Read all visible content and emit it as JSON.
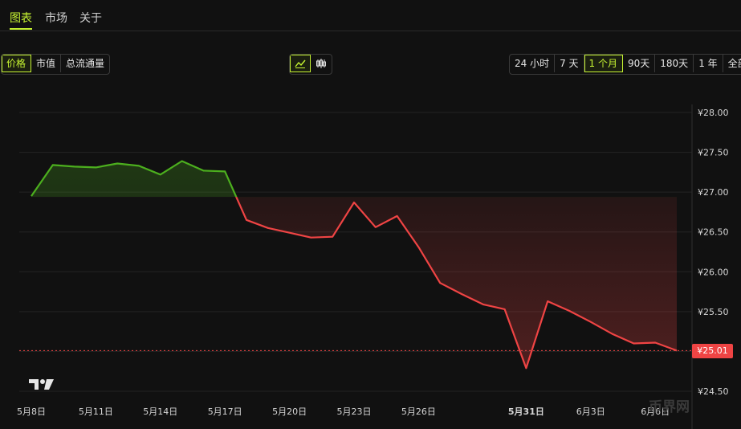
{
  "tabs": {
    "items": [
      "图表",
      "市场",
      "关于"
    ]
  },
  "metric_buttons": [
    "价格",
    "市值",
    "总流通量"
  ],
  "range_buttons": [
    "24 小时",
    "7 天",
    "1 个月",
    "90天",
    "180天",
    "1 年",
    "全部"
  ],
  "current_price_label": "¥25.01",
  "watermark": "币界网",
  "colors": {
    "accent": "#c6f432",
    "up": "#4caf1e",
    "down": "#ef4444",
    "background": "#111111"
  },
  "chart_data": {
    "type": "line",
    "x_tick_labels": [
      "5月8日",
      "5月11日",
      "5月14日",
      "5月17日",
      "5月20日",
      "5月23日",
      "5月26日",
      "5月31日",
      "6月3日",
      "6月6日"
    ],
    "x": [
      "05-08",
      "05-09",
      "05-10",
      "05-11",
      "05-12",
      "05-13",
      "05-14",
      "05-15",
      "05-16",
      "05-17",
      "05-18",
      "05-19",
      "05-20",
      "05-21",
      "05-22",
      "05-23",
      "05-24",
      "05-25",
      "05-26",
      "05-27",
      "05-28",
      "05-29",
      "05-30",
      "05-31",
      "06-01",
      "06-02",
      "06-03",
      "06-04",
      "06-05",
      "06-06",
      "06-07"
    ],
    "values": [
      26.95,
      27.34,
      27.32,
      27.31,
      27.36,
      27.33,
      27.22,
      27.39,
      27.27,
      27.26,
      26.65,
      26.55,
      26.49,
      26.43,
      26.44,
      26.87,
      26.56,
      26.7,
      26.31,
      25.86,
      25.72,
      25.59,
      25.53,
      24.79,
      25.63,
      25.51,
      25.37,
      25.22,
      25.1,
      25.11,
      25.01
    ],
    "baseline": 26.94,
    "y_tick_labels": [
      "¥28.00",
      "¥27.50",
      "¥27.00",
      "¥26.50",
      "¥26.00",
      "¥25.50",
      "¥24.50"
    ],
    "ylim": [
      24.5,
      28.0
    ],
    "last_value": 25.01,
    "grid": true
  }
}
